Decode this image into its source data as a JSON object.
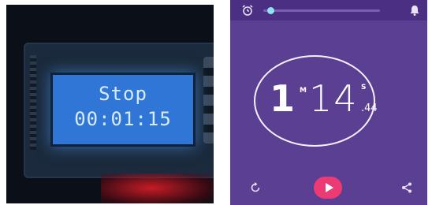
{
  "lcd": {
    "line1": "Stop",
    "line2": "00:01:15"
  },
  "stopwatch": {
    "minutes": "1",
    "minutes_label": "M",
    "seconds": "14",
    "seconds_label": "S",
    "hundredths": ".44",
    "progress": 0.05
  },
  "icons": {
    "top_left": "alarm-clock-icon",
    "top_right": "bell-icon",
    "reset": "reset-icon",
    "play": "play-icon",
    "share": "share-icon"
  },
  "colors": {
    "phone_background": "#5b3f92",
    "top_bar": "#4b2f83",
    "progress_knob": "#8fe3ef",
    "play_button": "#ec3a74",
    "lcd_background": "#2f76d6"
  }
}
